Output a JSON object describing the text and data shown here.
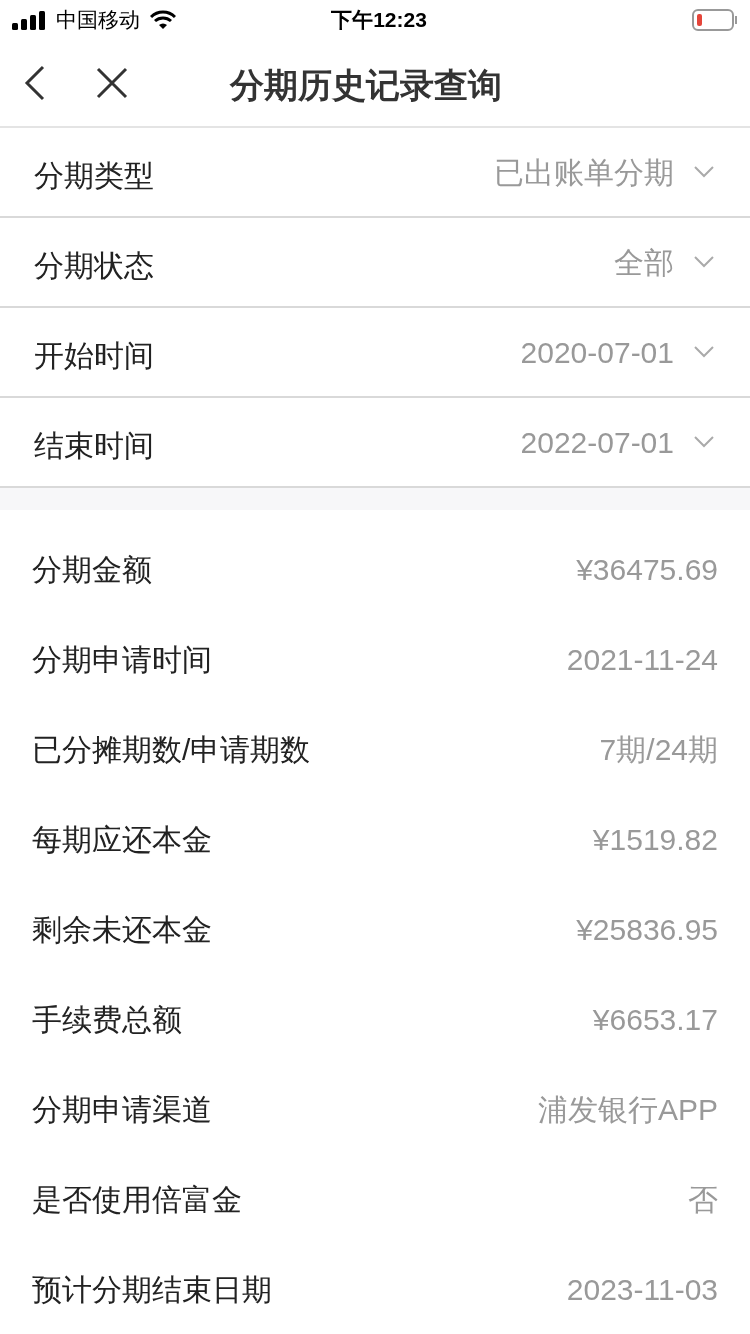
{
  "status_bar": {
    "carrier": "中国移动",
    "time": "下午12:23"
  },
  "nav": {
    "title": "分期历史记录查询"
  },
  "filters": [
    {
      "label": "分期类型",
      "value": "已出账单分期"
    },
    {
      "label": "分期状态",
      "value": "全部"
    },
    {
      "label": "开始时间",
      "value": "2020-07-01"
    },
    {
      "label": "结束时间",
      "value": "2022-07-01"
    }
  ],
  "details": [
    {
      "label": "分期金额",
      "value": "¥36475.69"
    },
    {
      "label": "分期申请时间",
      "value": "2021-11-24"
    },
    {
      "label": "已分摊期数/申请期数",
      "value": "7期/24期"
    },
    {
      "label": "每期应还本金",
      "value": "¥1519.82"
    },
    {
      "label": "剩余未还本金",
      "value": "¥25836.95"
    },
    {
      "label": "手续费总额",
      "value": "¥6653.17"
    },
    {
      "label": "分期申请渠道",
      "value": "浦发银行APP"
    },
    {
      "label": "是否使用倍富金",
      "value": "否"
    },
    {
      "label": "预计分期结束日期",
      "value": "2023-11-03"
    }
  ]
}
